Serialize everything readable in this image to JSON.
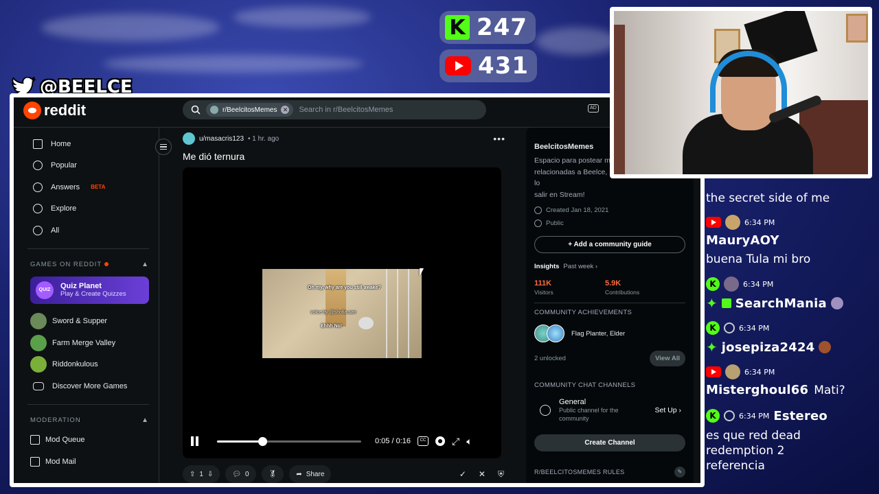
{
  "stream": {
    "kick_count": "247",
    "youtube_count": "431",
    "twitter_handle": "@BEELCE_"
  },
  "reddit": {
    "logo_text": "reddit",
    "search": {
      "chip_label": "r/BeelcitosMemes",
      "placeholder": "Search in r/BeelcitosMemes"
    },
    "nav": [
      {
        "label": "Home",
        "icon": "home-icon"
      },
      {
        "label": "Popular",
        "icon": "popular-icon"
      },
      {
        "label": "Answers",
        "icon": "answers-icon",
        "badge": "BETA"
      },
      {
        "label": "Explore",
        "icon": "explore-icon"
      },
      {
        "label": "All",
        "icon": "all-icon"
      }
    ],
    "games": {
      "heading": "GAMES ON REDDIT",
      "featured": {
        "badge": "QUIZ",
        "title": "Quiz Planet",
        "subtitle": "Play & Create Quizzes"
      },
      "items": [
        {
          "label": "Sword & Supper",
          "color": "#6a8a5a"
        },
        {
          "label": "Farm Merge Valley",
          "color": "#5aa04a"
        },
        {
          "label": "Riddonkulous",
          "color": "#7ab03a"
        },
        {
          "label": "Discover More Games",
          "color": "#000000"
        }
      ]
    },
    "moderation": {
      "heading": "MODERATION",
      "items": [
        {
          "label": "Mod Queue"
        },
        {
          "label": "Mod Mail"
        }
      ]
    },
    "post": {
      "user": "u/masacris123",
      "time": "• 1 hr. ago",
      "more": "•••",
      "title": "Me dió ternura",
      "video": {
        "subtitle1": "Oh my, why are you still awake?",
        "subtitle2": "voice by @shofia.san",
        "subtitle3": "Ehhh No!",
        "progress": 0.3125,
        "time": "0:05 / 0:16",
        "cc_label": "CC"
      },
      "upvotes": "1",
      "comments": "0",
      "share_label": "Share"
    },
    "community": {
      "name": "BeelcitosMemes",
      "description": "Espacio para postear m... relacionadas a Beelce, lo... salir en Stream!",
      "desc_line1": "Espacio para postear m",
      "desc_line2": "relacionadas a Beelce, lo",
      "desc_line3": "salir en Stream!",
      "created": "Created Jan 18, 2021",
      "visibility": "Public",
      "guide_button": "+ Add a community guide",
      "insights_label": "Insights",
      "insights_period": "Past week ›",
      "visitors_num": "111K",
      "visitors_label": "Visitors",
      "contrib_num": "5.9K",
      "contrib_label": "Contributions",
      "achievements_heading": "COMMUNITY ACHIEVEMENTS",
      "achievements_text": "Flag Planter, Elder",
      "unlocked": "2 unlocked",
      "view_all": "View All",
      "chat_heading": "COMMUNITY CHAT CHANNELS",
      "chat_name": "General",
      "chat_desc": "Public channel for the community",
      "setup": "Set Up  ›",
      "create_channel": "Create Channel",
      "rules_heading": "R/BEELCITOSMEMES RULES"
    }
  },
  "chat": [
    {
      "text": "the secret side of me"
    },
    {
      "platform": "youtube",
      "time": "6:34 PM",
      "user": "MauryAOY",
      "text": "buena Tula mi bro"
    },
    {
      "platform": "kick",
      "time": "6:34 PM",
      "user": "SearchMania"
    },
    {
      "platform": "kick",
      "time": "6:34 PM",
      "user": "josepiza2424"
    },
    {
      "platform": "youtube",
      "time": "6:34 PM",
      "user": "Misterghoul66",
      "text": "Mati?"
    },
    {
      "platform": "kick",
      "time": "6:34 PM",
      "user": "Estereo",
      "text": "es que red dead redemption 2 referencia"
    }
  ]
}
